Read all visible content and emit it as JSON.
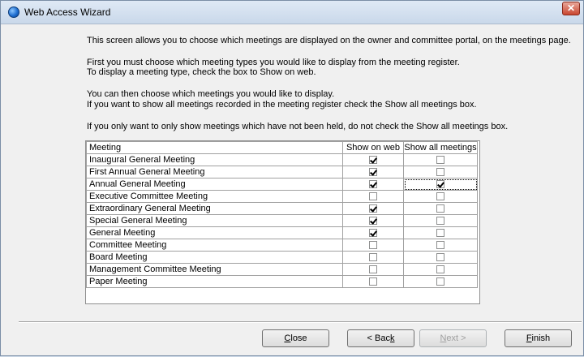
{
  "window": {
    "title": "Web Access Wizard",
    "close_glyph": "✕"
  },
  "intro": {
    "line1": "This screen allows you to choose which meetings are displayed on the owner and committee portal, on the meetings page.",
    "line2": "First you must choose which meeting types you would like to display from the meeting register.",
    "line3": "To display a meeting type, check the box to Show on web.",
    "line4": "You can then choose which meetings you would like to display.",
    "line5": "If you want to show all meetings recorded in the meeting register check the Show all meetings box.",
    "line6": "If you only want to only show meetings which have not been held, do not check the Show all meetings box."
  },
  "grid": {
    "columns": [
      "Meeting",
      "Show on web",
      "Show all meetings"
    ],
    "rows": [
      {
        "meeting": "Inaugural General Meeting",
        "show_on_web": true,
        "show_all": false
      },
      {
        "meeting": "First Annual General Meeting",
        "show_on_web": true,
        "show_all": false
      },
      {
        "meeting": "Annual General Meeting",
        "show_on_web": true,
        "show_all": true
      },
      {
        "meeting": "Executive Committee Meeting",
        "show_on_web": false,
        "show_all": false
      },
      {
        "meeting": "Extraordinary General Meeting",
        "show_on_web": true,
        "show_all": false
      },
      {
        "meeting": "Special General Meeting",
        "show_on_web": true,
        "show_all": false
      },
      {
        "meeting": "General Meeting",
        "show_on_web": true,
        "show_all": false
      },
      {
        "meeting": "Committee Meeting",
        "show_on_web": false,
        "show_all": false
      },
      {
        "meeting": "Board Meeting",
        "show_on_web": false,
        "show_all": false
      },
      {
        "meeting": "Management Committee Meeting",
        "show_on_web": false,
        "show_all": false
      },
      {
        "meeting": "Paper Meeting",
        "show_on_web": false,
        "show_all": false
      }
    ]
  },
  "buttons": {
    "close": {
      "mnemonic": "C",
      "rest": "lose"
    },
    "back": {
      "prefix": "< Bac",
      "mnemonic": "k",
      "rest": ""
    },
    "next": {
      "prefix": "",
      "mnemonic": "N",
      "rest": "ext >",
      "disabled": true
    },
    "finish": {
      "mnemonic": "F",
      "rest": "inish"
    }
  }
}
